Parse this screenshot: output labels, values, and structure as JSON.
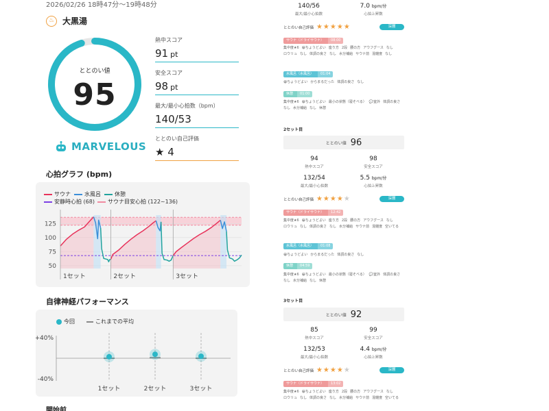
{
  "header": {
    "date": "2026/02/26 18時47分～19時48分",
    "facility": "大黒湯"
  },
  "summary": {
    "score_label": "ととのい値",
    "score": "95",
    "score_fraction": 0.95,
    "rank": "MARVELOUS",
    "metrics": [
      {
        "label": "熱中スコア",
        "value": "91",
        "unit": "pt"
      },
      {
        "label": "安全スコア",
        "value": "98",
        "unit": "pt"
      },
      {
        "label": "最大/最小心拍数（bpm）",
        "value": "140/53",
        "unit": ""
      },
      {
        "label": "ととのい自己評価",
        "value": "★ 4",
        "unit": ""
      }
    ]
  },
  "hr_section": {
    "title": "心拍グラフ (bpm)",
    "legend": [
      "サウナ",
      "水風呂",
      "休憩",
      "安静時心拍 (68)",
      "サウナ目安心拍 (122~136)"
    ],
    "y_ticks": [
      "125",
      "100",
      "75",
      "50"
    ],
    "set_labels": [
      "1セット",
      "2セット",
      "3セット"
    ]
  },
  "perf_section": {
    "title": "自律神経パフォーマンス",
    "legend_current": "今回",
    "legend_average": "これまでの平均",
    "y_top": "+40%",
    "y_bottom": "-40%",
    "set_labels": [
      "1セット",
      "2セット",
      "3セット"
    ]
  },
  "start_label": "開始前",
  "colors": {
    "accent": "#2ab7c7",
    "sauna": "#e8325a",
    "water": "#3b8fd9",
    "rest": "#20a39e",
    "resting": "#7b3fe4",
    "target": "#f08aa0",
    "orange": "#f0a040"
  },
  "chart_data": [
    {
      "type": "line",
      "title": "心拍グラフ (bpm)",
      "ylim": [
        45,
        140
      ],
      "y_ticks": [
        50,
        75,
        100,
        125
      ],
      "resting_hr": 68,
      "target_band": [
        122,
        136
      ],
      "x_categories": [
        "1セット",
        "2セット",
        "3セット"
      ],
      "series": [
        {
          "name": "サウナ",
          "color": "#e8325a",
          "points": [
            [
              0,
              85
            ],
            [
              6,
              97
            ],
            [
              12,
              106
            ],
            [
              18,
              113
            ],
            [
              24,
              119
            ],
            [
              28,
              127
            ],
            [
              31,
              133
            ],
            [
              33,
              137
            ],
            [
              50,
              61
            ],
            [
              52,
              70
            ],
            [
              58,
              78
            ],
            [
              64,
              88
            ],
            [
              70,
              97
            ],
            [
              76,
              105
            ],
            [
              82,
              112
            ],
            [
              88,
              120
            ],
            [
              92,
              126
            ],
            [
              95,
              130
            ],
            [
              112,
              68
            ],
            [
              115,
              75
            ],
            [
              120,
              82
            ],
            [
              126,
              90
            ],
            [
              132,
              98
            ],
            [
              138,
              105
            ],
            [
              144,
              111
            ],
            [
              150,
              118
            ],
            [
              155,
              125
            ],
            [
              159,
              131
            ]
          ]
        },
        {
          "name": "水風呂",
          "color": "#3b8fd9",
          "points": [
            [
              33,
              137
            ],
            [
              35,
              126
            ],
            [
              37,
              98
            ],
            [
              38,
              131
            ],
            [
              40,
              117
            ],
            [
              95,
              130
            ],
            [
              97,
              118
            ],
            [
              99,
              112
            ],
            [
              100,
              128
            ],
            [
              159,
              131
            ],
            [
              161,
              116
            ],
            [
              163,
              128
            ],
            [
              165,
              111
            ]
          ]
        },
        {
          "name": "休憩",
          "color": "#20a39e",
          "points": [
            [
              40,
              117
            ],
            [
              41,
              80
            ],
            [
              43,
              63
            ],
            [
              45,
              62
            ],
            [
              47,
              61
            ],
            [
              48,
              57
            ],
            [
              49,
              61
            ],
            [
              50,
              61
            ],
            [
              100,
              128
            ],
            [
              101,
              72
            ],
            [
              103,
              61
            ],
            [
              106,
              60
            ],
            [
              108,
              58
            ],
            [
              110,
              60
            ],
            [
              112,
              68
            ],
            [
              165,
              111
            ],
            [
              166,
              78
            ],
            [
              168,
              64
            ],
            [
              171,
              62
            ],
            [
              173,
              58
            ],
            [
              176,
              61
            ],
            [
              178,
              64
            ],
            [
              180,
              69
            ]
          ]
        }
      ]
    },
    {
      "type": "scatter",
      "title": "自律神経パフォーマンス",
      "ylim": [
        -40,
        40
      ],
      "categories": [
        "1セット",
        "2セット",
        "3セット"
      ],
      "series": [
        {
          "name": "今回",
          "values": [
            3,
            8,
            4
          ]
        },
        {
          "name": "これまでの平均",
          "values": [
            0,
            1,
            0
          ]
        }
      ]
    }
  ],
  "right_panel": {
    "top_metrics": [
      {
        "value": "140/56",
        "label": "最大/最小心拍数"
      },
      {
        "value": "7.0",
        "unit": "bpm/分",
        "label": "心拍上昇数"
      }
    ],
    "sets": [
      {
        "title": "",
        "score_label": "",
        "score": "",
        "metrics": [],
        "self_label": "ととのい自己評価",
        "stars": 5,
        "badge": "深層",
        "sauna_chip": [
          "サウナ（ドライサウナ）",
          "08:00"
        ],
        "sauna_tags": [
          "集中度★6",
          "😀ちょうどよい",
          "座り方",
          "2段",
          "腰の方",
          "アウフグース",
          "なし",
          "ロウリュ",
          "なし",
          "体調の良さ",
          "なし",
          "水分補給",
          "サウナ前",
          "混雑度",
          "なし"
        ],
        "water_chip": [
          "水風呂（水風呂）",
          "01:04"
        ],
        "water_tags": [
          "😀ちょうどよい",
          "からまるだった",
          "体調の良さ",
          "なし"
        ],
        "rest_chip": [
          "休憩",
          "01:00"
        ],
        "rest_tags": [
          "集中度★6",
          "😀ちょうどよい",
          "最小の状態（寝そべる）",
          "💬室外",
          "体調の良さ",
          "なし",
          "水分補給",
          "なし",
          "休憩"
        ]
      },
      {
        "title": "2セット目",
        "score_label": "ととのい値",
        "score": "96",
        "metrics": [
          {
            "value": "94",
            "label": "熱中スコア"
          },
          {
            "value": "98",
            "label": "安全スコア"
          },
          {
            "value": "132/54",
            "label": "最大/最小心拍数"
          },
          {
            "value": "5.5",
            "unit": "bpm/分",
            "label": "心拍上昇数"
          }
        ],
        "self_label": "ととのい自己評価",
        "stars": 4,
        "badge": "深層",
        "sauna_chip": [
          "サウナ（ドライサウナ）",
          "12:42"
        ],
        "sauna_tags": [
          "集中度★6",
          "😀ちょうどよい",
          "座り方",
          "2段",
          "腰の方",
          "アウフグース",
          "なし",
          "ロウリュ",
          "なし",
          "体調の良さ",
          "なし",
          "水分補給",
          "サウナ前",
          "混雑度",
          "空いてる"
        ],
        "water_chip": [
          "水風呂（水風呂）",
          "01:08"
        ],
        "water_tags": [
          "😀ちょうどよい",
          "からまるだった",
          "体調の良さ",
          "なし"
        ],
        "rest_chip": [
          "休憩",
          "04:59"
        ],
        "rest_tags": [
          "集中度★6",
          "😀ちょうどよい",
          "最小の状態（寝そべる）",
          "💬室外",
          "体調の良さ",
          "なし",
          "水分補給",
          "なし",
          "休憩"
        ]
      },
      {
        "title": "3セット目",
        "score_label": "ととのい値",
        "score": "92",
        "metrics": [
          {
            "value": "85",
            "label": "熱中スコア"
          },
          {
            "value": "99",
            "label": "安全スコア"
          },
          {
            "value": "132/53",
            "label": "最大/最小心拍数"
          },
          {
            "value": "4.4",
            "unit": "bpm/分",
            "label": "心拍上昇数"
          }
        ],
        "self_label": "ととのい自己評価",
        "stars": 4,
        "badge": "深層",
        "sauna_chip": [
          "サウナ（ドライサウナ）",
          "13:02"
        ],
        "sauna_tags": [
          "集中度★6",
          "😀ちょうどよい",
          "座り方",
          "2段",
          "腰の方",
          "アウフグース",
          "なし",
          "ロウリュ",
          "なし",
          "体調の良さ",
          "なし",
          "水分補給",
          "サウナ前",
          "混雑度",
          "空いてる"
        ]
      }
    ]
  }
}
